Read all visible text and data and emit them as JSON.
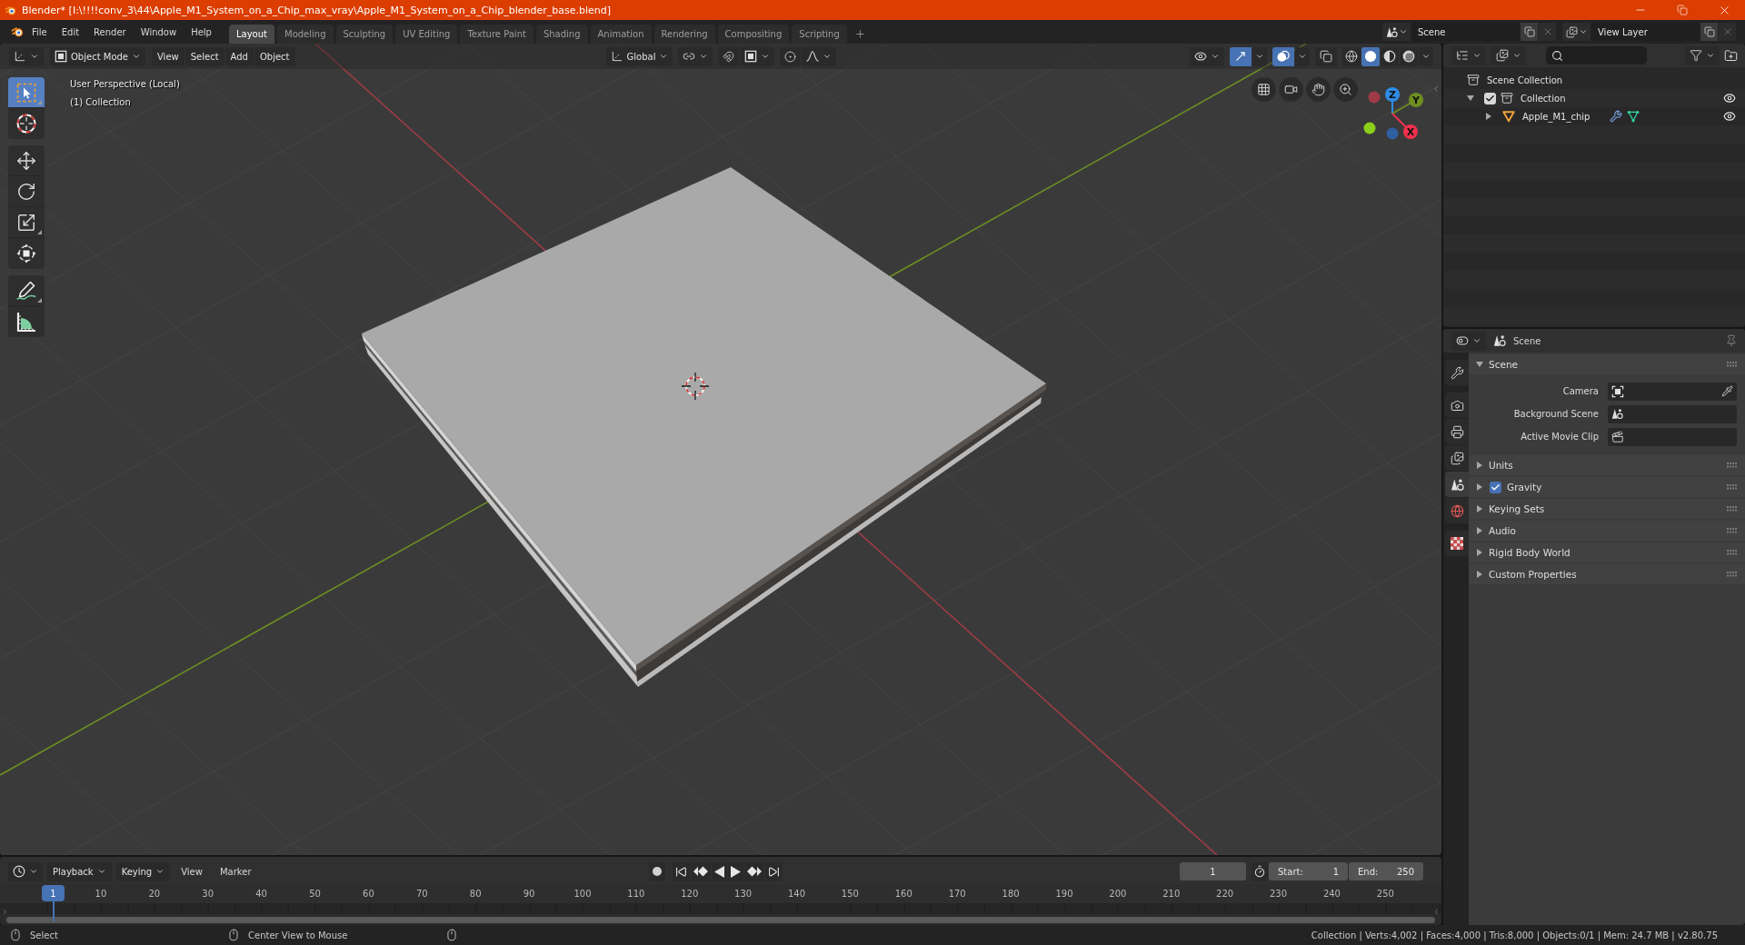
{
  "window": {
    "title": "Blender* [I:\\!!!!conv_3\\44\\Apple_M1_System_on_a_Chip_max_vray\\Apple_M1_System_on_a_Chip_blender_base.blend]"
  },
  "menu_bar": [
    "File",
    "Edit",
    "Render",
    "Window",
    "Help"
  ],
  "workspace_tabs": [
    {
      "label": "Layout",
      "selected": true
    },
    {
      "label": "Modeling",
      "selected": false
    },
    {
      "label": "Sculpting",
      "selected": false
    },
    {
      "label": "UV Editing",
      "selected": false
    },
    {
      "label": "Texture Paint",
      "selected": false
    },
    {
      "label": "Shading",
      "selected": false
    },
    {
      "label": "Animation",
      "selected": false
    },
    {
      "label": "Rendering",
      "selected": false
    },
    {
      "label": "Compositing",
      "selected": false
    },
    {
      "label": "Scripting",
      "selected": false
    }
  ],
  "scene_selector": {
    "value": "Scene"
  },
  "view_layer_selector": {
    "value": "View Layer"
  },
  "viewport": {
    "header": {
      "mode": "Object Mode",
      "menus": [
        "View",
        "Select",
        "Add",
        "Object"
      ],
      "orientation": "Global",
      "toggles": [
        {
          "kind": "gizmos",
          "on": true
        },
        {
          "kind": "overlays",
          "on": true
        },
        {
          "kind": "xray",
          "on": false
        }
      ],
      "shading": [
        {
          "kind": "wireframe",
          "selected": false
        },
        {
          "kind": "solid",
          "selected": true
        },
        {
          "kind": "material",
          "selected": false
        },
        {
          "kind": "rendered",
          "selected": false
        }
      ]
    },
    "info": [
      "User Perspective (Local)",
      "(1) Collection"
    ],
    "tool_groups": [
      {
        "tools": [
          {
            "kind": "select_box",
            "selected": true
          },
          {
            "kind": "cursor",
            "selected": false
          }
        ]
      },
      {
        "tools": [
          {
            "kind": "move",
            "selected": false
          },
          {
            "kind": "rotate",
            "selected": false
          },
          {
            "kind": "scale",
            "selected": false
          },
          {
            "kind": "transform",
            "selected": false
          }
        ]
      },
      {
        "tools": [
          {
            "kind": "annotate",
            "selected": false
          },
          {
            "kind": "measure",
            "selected": false
          }
        ]
      }
    ],
    "axis_gizmo": [
      {
        "kind": "z",
        "label": "Z",
        "color": "#2e8ce6"
      },
      {
        "kind": "y",
        "label": "Y",
        "color": "#6e8e20"
      },
      {
        "kind": "x",
        "label": "X",
        "color": "#f0304c"
      }
    ]
  },
  "outliner": {
    "tree": [
      {
        "label": "Scene Collection",
        "kind": "scene_collection",
        "children": [
          {
            "label": "Collection",
            "kind": "collection",
            "expanded": true,
            "checked": true,
            "visible": true,
            "children": [
              {
                "label": "Apple_M1_chip",
                "kind": "mesh_object",
                "expanded": false,
                "visible": true
              }
            ]
          }
        ]
      }
    ]
  },
  "properties": {
    "context": "Scene",
    "tab_groups": [
      {
        "tabs": [
          {
            "kind": "tool",
            "selected": false
          }
        ]
      },
      {
        "tabs": [
          {
            "kind": "render",
            "selected": false
          },
          {
            "kind": "output",
            "selected": false
          },
          {
            "kind": "view_layer",
            "selected": false
          },
          {
            "kind": "scene",
            "selected": true
          },
          {
            "kind": "world",
            "selected": false
          }
        ]
      },
      {
        "tabs": [
          {
            "kind": "texture",
            "selected": false
          }
        ]
      }
    ],
    "panels": [
      {
        "title": "Scene",
        "kind": "plain",
        "expanded": true,
        "fields": [
          {
            "label": "Camera",
            "kind": "camera"
          },
          {
            "label": "Background Scene",
            "kind": "scene"
          },
          {
            "label": "Active Movie Clip",
            "kind": "movie_clip"
          }
        ]
      },
      {
        "title": "Units",
        "kind": "plain",
        "expanded": false
      },
      {
        "title": "Gravity",
        "kind": "toggle",
        "expanded": false,
        "checked": true
      },
      {
        "title": "Keying Sets",
        "kind": "plain",
        "expanded": false
      },
      {
        "title": "Audio",
        "kind": "plain",
        "expanded": false
      },
      {
        "title": "Rigid Body World",
        "kind": "plain",
        "expanded": false
      },
      {
        "title": "Custom Properties",
        "kind": "plain",
        "expanded": false
      }
    ]
  },
  "timeline": {
    "menus": [
      {
        "label": "Playback",
        "kind": "dropdown"
      },
      {
        "label": "Keying",
        "kind": "dropdown"
      },
      {
        "label": "View",
        "kind": "menu"
      },
      {
        "label": "Marker",
        "kind": "menu"
      }
    ],
    "current_frame": "1",
    "start": {
      "label": "Start:",
      "value": "1"
    },
    "end": {
      "label": "End:",
      "value": "250"
    },
    "playhead": "1",
    "ruler": [
      "10",
      "20",
      "30",
      "40",
      "50",
      "60",
      "70",
      "80",
      "90",
      "100",
      "110",
      "120",
      "130",
      "140",
      "150",
      "160",
      "170",
      "180",
      "190",
      "200",
      "210",
      "220",
      "230",
      "240",
      "250"
    ]
  },
  "status_bar": {
    "hints": [
      "Select",
      "Center View to Mouse"
    ],
    "stats": "Collection | Verts:4,002 | Faces:4,000 | Tris:8,000 | Objects:0/1 | Mem: 24.7 MB | v2.80.75"
  }
}
